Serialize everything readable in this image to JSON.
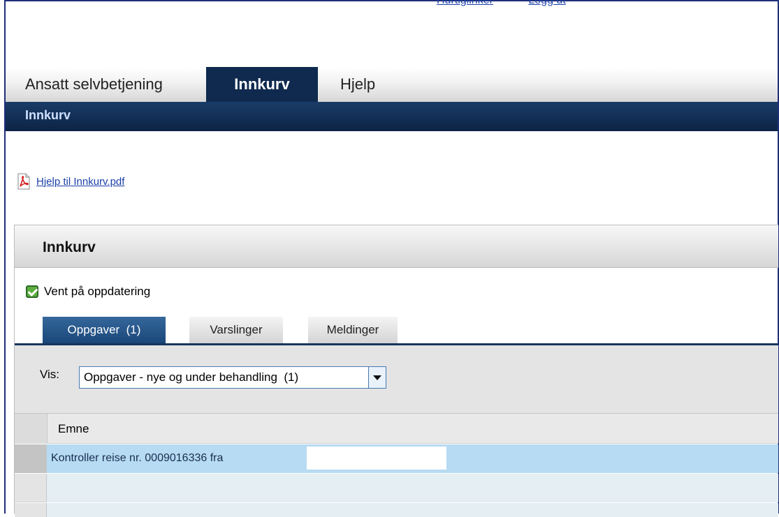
{
  "top_links": [
    "Hurtiglinker",
    "Logg ut"
  ],
  "main_tabs": [
    {
      "label": "Ansatt selvbetjening",
      "active": false
    },
    {
      "label": "Innkurv",
      "active": true
    },
    {
      "label": "Hjelp",
      "active": false
    }
  ],
  "sub_header": {
    "title": "Innkurv"
  },
  "help_link": {
    "icon": "pdf-icon",
    "label": "Hjelp til Innkurv.pdf"
  },
  "panel": {
    "title": "Innkurv",
    "wait_checkbox": {
      "label": "Vent på oppdatering",
      "checked": true
    },
    "tabs": [
      {
        "label": "Oppgaver  (1)",
        "active": true
      },
      {
        "label": "Varslinger",
        "active": false
      },
      {
        "label": "Meldinger",
        "active": false
      }
    ],
    "filter": {
      "label": "Vis:",
      "selected": "Oppgaver - nye og under behandling  (1)"
    },
    "grid": {
      "column": "Emne",
      "rows": [
        {
          "emne": "Kontroller reise nr. 0009016336 fra",
          "selected": true
        }
      ]
    }
  },
  "colors": {
    "nav_dark": "#0f2a4e",
    "row_selected": "#b6dbf2",
    "link": "#1a3fa8"
  }
}
